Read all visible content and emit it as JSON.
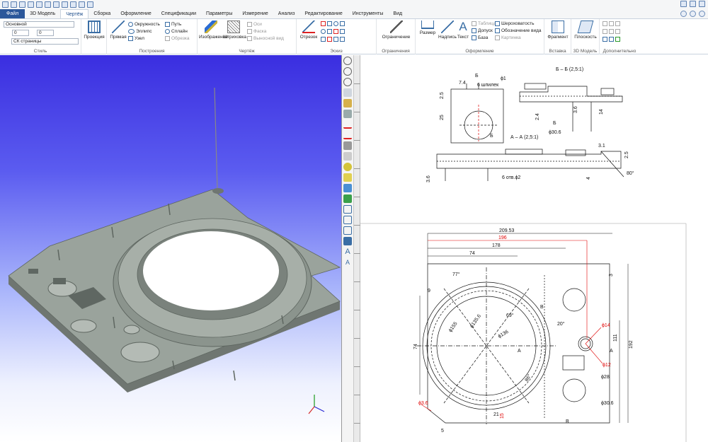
{
  "ribbon_tabs": {
    "file": "Файл",
    "model3d": "3D Модель",
    "drawing": "Чертёж",
    "assembly": "Сборка",
    "design": "Оформление",
    "specs": "Спецификации",
    "params": "Параметры",
    "measure": "Измерение",
    "analysis": "Анализ",
    "edit": "Редактирование",
    "tools": "Инструменты",
    "view": "Вид"
  },
  "style_group": {
    "layer": "Основной",
    "value1": "0",
    "value2": "0",
    "cs": "СК страницы",
    "label": "Стиль"
  },
  "ribbon": {
    "projection": "Проекция",
    "line": "Прямая",
    "circle": "Окружность",
    "ellipse": "Эллипс",
    "node": "Узел",
    "path": "Путь",
    "spline": "Сплайн",
    "offset": "Обрезка",
    "construction_label": "Построения",
    "image": "Изображение",
    "hatch": "Штриховка",
    "axes": "Оси",
    "chamfer": "Фаска",
    "leader_view": "Выносной вид",
    "drawing_label": "Чертёж",
    "segment": "Отрезок",
    "sketch_label": "Эскиз",
    "constraint": "Ограничение",
    "constraints_label": "Ограничения",
    "dimension": "Размер",
    "caption": "Надпись",
    "text": "Текст",
    "table": "Таблица",
    "tolerance": "Допуск",
    "base": "База",
    "roughness": "Шероховатость",
    "view_mark": "Обозначение вида",
    "picture": "Картинка",
    "design_label": "Оформление",
    "fragment": "Фрагмент",
    "insert_label": "Вставка",
    "plane": "Плоскость",
    "model3d_label": "3D Модель",
    "extra_label": "Дополнительно"
  },
  "drawing": {
    "section_bb": "Б – Б (2,5:1)",
    "section_aa": "А – А (2,5:1)",
    "dim_phi1": "ϕ1",
    "studs": "6 шпилек",
    "dim_74a": "7.4",
    "dim_25a": "2.5",
    "dim_25b": "25",
    "mark_b": "Б",
    "dim_24": "2.4",
    "dim_36": "3.6",
    "dim_14": "14",
    "dim_phi306": "ϕ30.6",
    "dim_31": "3.1",
    "dim_25c": "2.5",
    "dim_80": "80°",
    "dim_36b": "3.6",
    "holes": "6 отв.ϕ2",
    "dim_4": "4",
    "dim_20953": "209.53",
    "dim_196": "196",
    "dim_178": "178",
    "dim_74": "74",
    "dim_9": "9",
    "dim_3": "3",
    "dim_77": "77°",
    "dim_69": "69°",
    "dim_phi155": "ϕ155",
    "dim_phi1356": "ϕ135.6",
    "dim_phi136": "ϕ136",
    "dim_20": "20°",
    "dim_phi14": "ϕ14",
    "dim_111": "111",
    "dim_192": "192",
    "dim_phi12": "ϕ12",
    "dim_phi28": "ϕ28",
    "dim_74v": "74",
    "dim_86": "86°",
    "dim_phi306b": "ϕ30.6",
    "dim_phi36": "ϕ3.6",
    "dim_5": "5",
    "dim_21": "21",
    "dim_15": "15",
    "mark_a": "A",
    "mark_b2": "B"
  },
  "colors": {
    "accent": "#2b579a",
    "dim_red": "#e00000",
    "model": "#9aa39c"
  }
}
